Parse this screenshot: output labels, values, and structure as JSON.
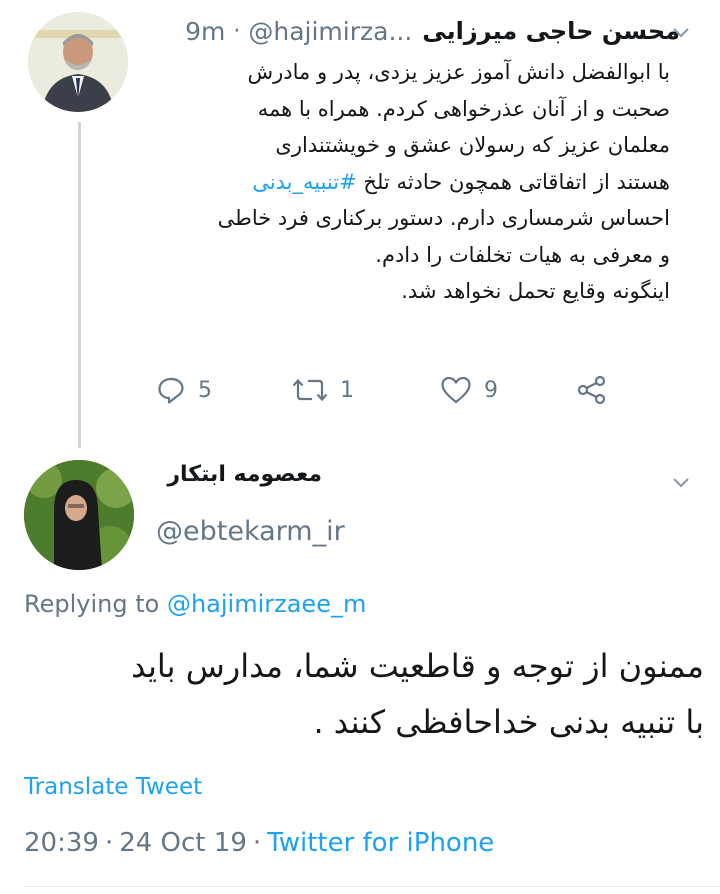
{
  "tweet1": {
    "display_name": "محسن حاجی میرزایی",
    "handle": "@hajimirza...",
    "time": "9m",
    "body_lines": [
      "با ابوالفضل دانش آموز عزیز یزدی، پدر و مادرش",
      "صحبت و از آنان عذرخواهی کردم. همراه با همه",
      "معلمان عزیز که رسولان عشق و  خویشتنداری",
      "هستند از اتفاقاتی همچون حادثه تلخ ",
      "احساس شرمساری دارم. دستور برکناری فرد خاطی",
      "و معرفی به هیات تخلفات را دادم.",
      "اینگونه وقایع تحمل نخواهد شد."
    ],
    "hashtag": "#تنبیه_بدنی",
    "actions": {
      "reply_count": "5",
      "retweet_count": "1",
      "like_count": "9"
    },
    "icons": {
      "reply": "reply-icon",
      "retweet": "retweet-icon",
      "like": "heart-icon",
      "share": "share-icon",
      "menu": "chevron-down-icon"
    }
  },
  "tweet2": {
    "display_name": "معصومه ابتکار",
    "handle": "@ebtekarm_ir",
    "replying_prefix": "Replying to",
    "replying_to": "@hajimirzaee_m",
    "body_lines": [
      "ممنون از توجه و قاطعیت شما، مدارس باید",
      "با تنبیه بدنی خداحافظی کنند ."
    ],
    "translate_label": "Translate Tweet",
    "time": "20:39",
    "date": "24 Oct 19",
    "source": "Twitter for iPhone",
    "separator": "·"
  },
  "colors": {
    "link": "#1da1f2",
    "secondary": "#657786",
    "text": "#14171a",
    "thread_line": "#ccd6dd"
  }
}
